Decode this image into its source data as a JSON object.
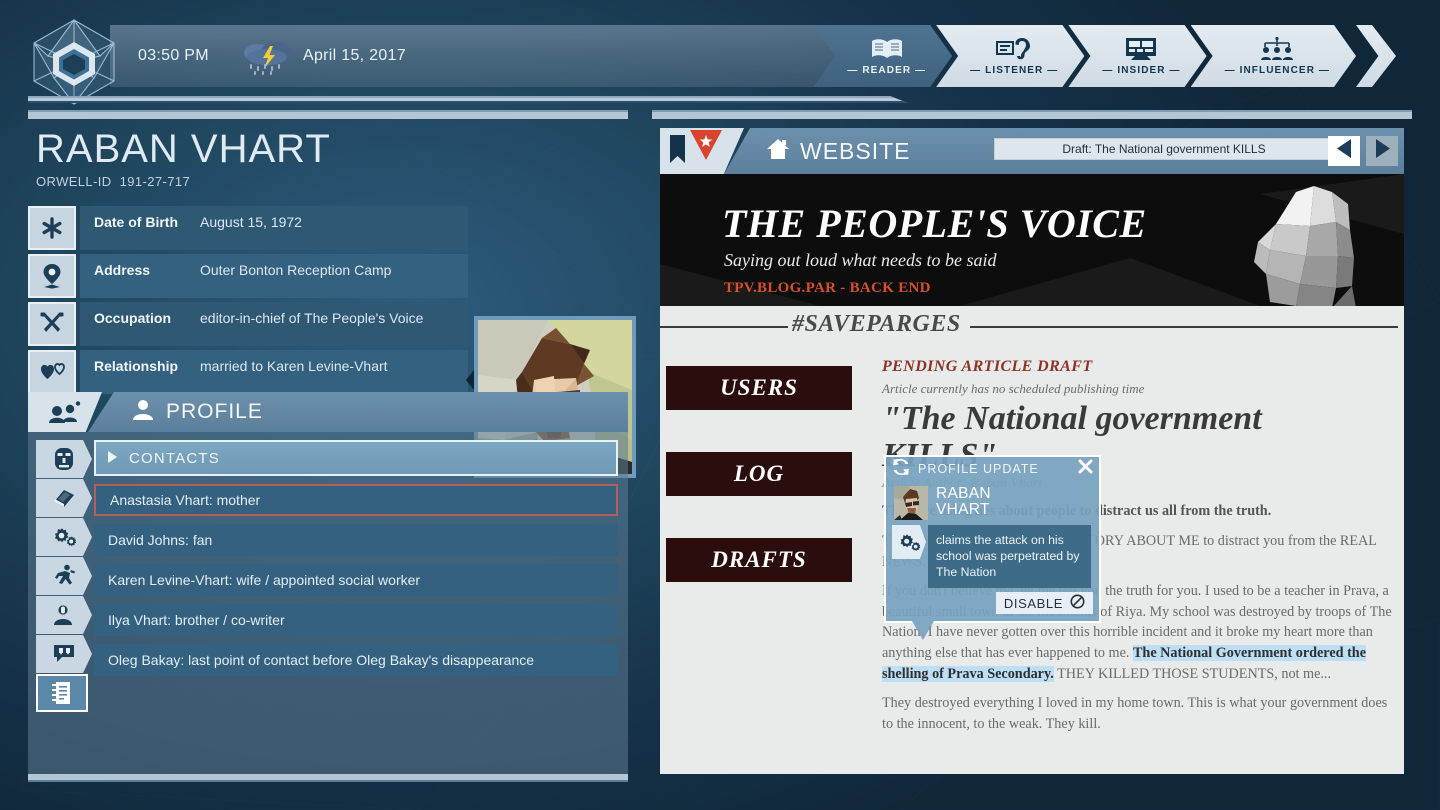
{
  "topbar": {
    "logo_icon": "orwell-hex-logo",
    "time": "03:50 PM",
    "weather_icon": "thunderstorm-icon",
    "date": "April 15, 2017",
    "ranks": [
      {
        "label": "— READER —",
        "icon": "open-book-icon",
        "state": "active"
      },
      {
        "label": "— LISTENER —",
        "icon": "ear-audio-icon",
        "state": "light"
      },
      {
        "label": "— INSIDER —",
        "icon": "monitor-icon",
        "state": "light"
      },
      {
        "label": "— INFLUENCER —",
        "icon": "crowd-people-icon",
        "state": "light"
      }
    ]
  },
  "citizen": {
    "name": "RABAN VHART",
    "id_label": "ORWELL-ID",
    "id_value": "191-27-717",
    "portrait_icon": "citizen-portrait",
    "facts": [
      {
        "icon": "asterisk-birth-icon",
        "label": "Date of Birth",
        "value": "August 15, 1972"
      },
      {
        "icon": "map-pin-icon",
        "label": "Address",
        "value": "Outer Bonton Reception Camp"
      },
      {
        "icon": "crossed-tools-icon",
        "label": "Occupation",
        "value": "editor-in-chief of The People's Voice"
      },
      {
        "icon": "hearts-icon",
        "label": "Relationship",
        "value": "married to Karen Levine-Vhart"
      }
    ]
  },
  "profile": {
    "tab_icon": "people-group-icon",
    "title_icon": "person-icon",
    "title": "PROFILE",
    "rail": [
      {
        "icon": "face-icon",
        "selected": false
      },
      {
        "icon": "book-icon",
        "selected": false
      },
      {
        "icon": "gears-icon",
        "selected": false
      },
      {
        "icon": "running-man-icon",
        "selected": false
      },
      {
        "icon": "person-badge-icon",
        "selected": false
      },
      {
        "icon": "speech-bubble-icon",
        "selected": false
      },
      {
        "icon": "notebook-icon",
        "selected": true
      }
    ],
    "section_arrow_icon": "triangle-right-icon",
    "section_label": "CONTACTS",
    "contacts": [
      {
        "text": "Anastasia Vhart: mother",
        "highlighted": true
      },
      {
        "text": "David Johns: fan",
        "highlighted": false
      },
      {
        "text": "Karen Levine-Vhart: wife / appointed social worker",
        "highlighted": false
      },
      {
        "text": "Ilya Vhart: brother / co-writer",
        "highlighted": false
      },
      {
        "text": "Oleg Bakay: last point of contact before Oleg Bakay's disappearance",
        "highlighted": false
      }
    ]
  },
  "browser": {
    "bookmark_icon": "bookmark-icon",
    "flag_icon": "red-star-flag-icon",
    "home_icon": "home-icon",
    "title": "WEBSITE",
    "url": "Draft: The National government KILLS",
    "prev_icon": "arrow-left-icon",
    "next_icon": "arrow-right-icon"
  },
  "site": {
    "banner_title": "THE PEOPLE'S VOICE",
    "banner_subtitle": "Saying out loud what needs to be said",
    "banner_url": "TPV.BLOG.PAR - BACK END",
    "banner_art_icon": "raised-fist-icon",
    "hashtag": "#SAVEPARGES",
    "menu": [
      "USERS",
      "LOG",
      "DRAFTS"
    ]
  },
  "article": {
    "kicker": "PENDING ARTICLE DRAFT",
    "schedule": "Article currently has no scheduled publishing time",
    "title_line1": "\"The National government",
    "title_line2": "KILLS\"",
    "author": "Article Author: Raban Vhart",
    "paragraphs": [
      {
        "text": "They are using lies about people to distract us all from the truth.",
        "style": "bold"
      },
      {
        "text": "THEY HAVE INVENTED THAT STORY ABOUT ME to distract you from the REAL NEWS.",
        "style": "normal"
      }
    ],
    "body_lead": "If you don't believe me, let me tell you the truth for you. I used to be a teacher in Prava, a beautiful small town in the mountains of Riya. My school was destroyed by troops of The Nation. I have never gotten over this horrible incident and it broke my heart more than anything else that has ever happened to me. ",
    "body_highlight": "The National Government ordered the shelling of Prava Secondary.",
    "body_tail": " THEY KILLED THOSE STUDENTS, not me...",
    "body_last": "They destroyed everything I loved in my home town. This is what your government does to the innocent, to the weak. They kill."
  },
  "popup": {
    "refresh_icon": "refresh-sync-icon",
    "title": "PROFILE UPDATE",
    "close_icon": "close-icon",
    "avatar_icon": "raban-avatar",
    "person_name_line1": "RABAN",
    "person_name_line2": "VHART",
    "claim_icon": "gears-icon",
    "claim_text": "claims the attack on his school was perpetrated by The Nation",
    "disable_label": "DISABLE",
    "disable_icon": "block-circle-icon"
  },
  "colors": {
    "accent_blue": "#5c7f9c",
    "panel_bg": "#2f5873",
    "page_bg": "#e9eaea",
    "menu_dark": "#2b0d0d",
    "kicker_red": "#8d3226",
    "banner_url_orange": "#d7502b",
    "highlight_blue": "#bddff5",
    "contact_highlight_border": "#b0605e"
  }
}
